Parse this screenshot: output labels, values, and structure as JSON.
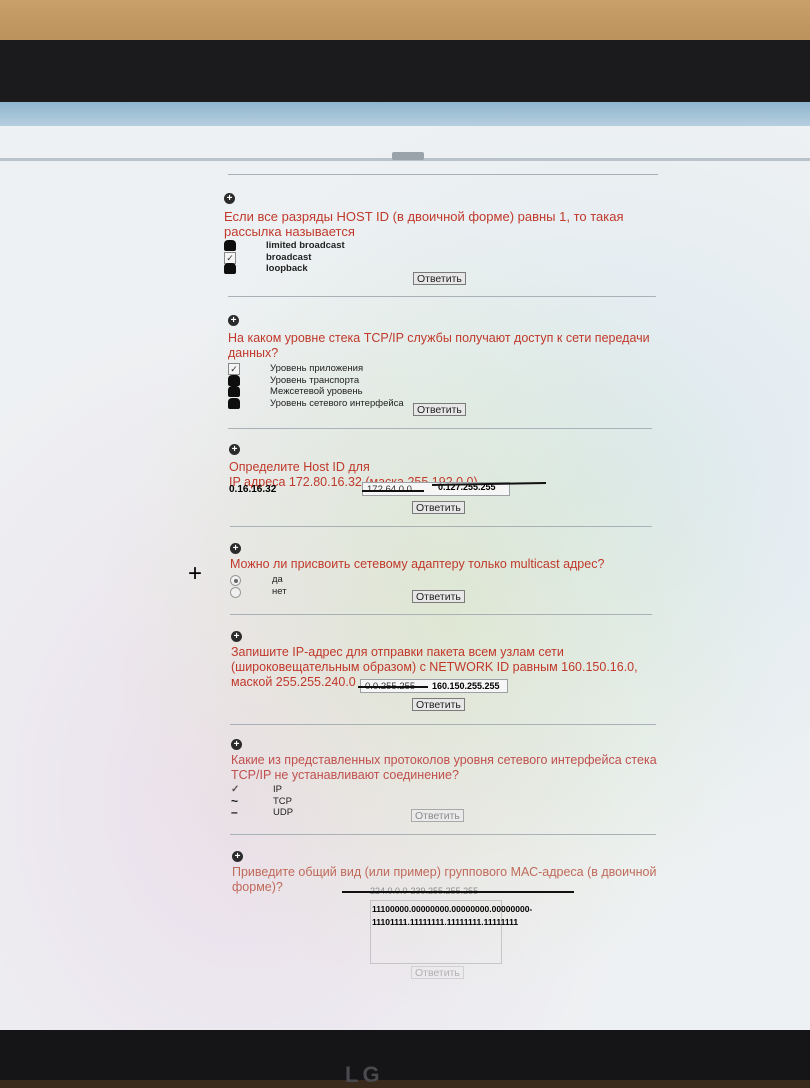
{
  "colors": {
    "question": "#c0392b",
    "screen_bg": "#eef1f3",
    "bezel": "#1b1b1d"
  },
  "monitor": {
    "brand": "LG"
  },
  "button_label": "Ответить",
  "questions": [
    {
      "text": "Если все разряды HOST ID (в двоичной форме) равны 1, то такая рассылка называется",
      "options": [
        "limited broadcast",
        "broadcast",
        "loopback"
      ]
    },
    {
      "text": "На каком уровне стека TCP/IP службы получают доступ к сети передачи данных?",
      "options": [
        "Уровень приложения",
        "Уровень транспорта",
        "Межсетевой уровень",
        "Уровень сетевого интерфейса"
      ]
    },
    {
      "text_line1": "Определите Host ID для",
      "text_line2": "IP адреса 172.80.16.32 (маска 255.192.0.0)",
      "handwritten_answer": "0.16.16.32",
      "field_value": "172.64.0.0",
      "handwritten_field": "0.127.255.255"
    },
    {
      "text": "Можно ли присвоить сетевому адаптеру только multicast адрес?",
      "options": [
        "да",
        "нет"
      ],
      "handwritten_mark": "+"
    },
    {
      "text": "Запишите IP-адрес для отправки пакета всем узлам сети (широковещательным образом) с NETWORK ID равным 160.150.16.0, маской 255.255.240.0",
      "field_value": "0.0.255.255",
      "handwritten_answer": "160.150.255.255"
    },
    {
      "text": "Какие из представленных протоколов уровня сетевого интерфейса стека TCP/IP не устанавливают соединение?",
      "options": [
        "IP",
        "TCP",
        "UDP"
      ]
    },
    {
      "text": "Приведите общий вид (или пример) группового МАС-адреса (в двоичной форме)?",
      "field_value": "224.0.0.0-239.255.255.255",
      "handwritten_line1": "11100000.00000000.00000000.00000000-",
      "handwritten_line2": "11101111.11111111.11111111.11111111"
    }
  ]
}
